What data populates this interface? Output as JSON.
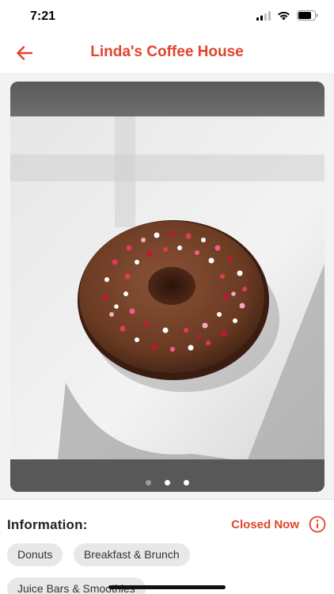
{
  "status_bar": {
    "time": "7:21"
  },
  "header": {
    "title": "Linda's Coffee House",
    "back_icon": "arrow-left-icon"
  },
  "gallery": {
    "page_count": 3,
    "active_page": 1
  },
  "info": {
    "heading": "Information:",
    "status": "Closed Now",
    "status_icon": "info-icon",
    "categories": [
      "Donuts",
      "Breakfast & Brunch",
      "Juice Bars & Smoothies"
    ]
  },
  "colors": {
    "accent": "#e0452a",
    "chip_bg": "#e8e8e8",
    "content_bg": "#f2f2f2"
  }
}
